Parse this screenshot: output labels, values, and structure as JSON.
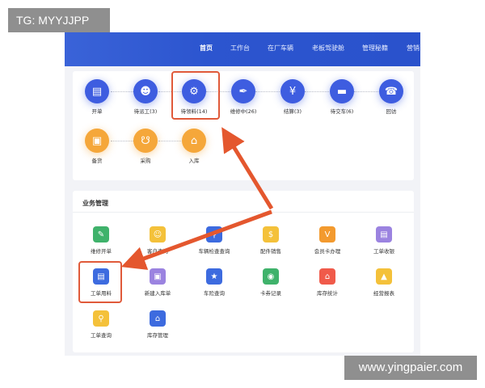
{
  "watermarks": {
    "top_left": "TG: MYYJJPP",
    "bottom_right": "www.yingpaier.com"
  },
  "nav": {
    "items": [
      {
        "label": "首页",
        "active": true
      },
      {
        "label": "工作台"
      },
      {
        "label": "在厂车辆"
      },
      {
        "label": "老板驾驶舱"
      },
      {
        "label": "管理秘籍"
      },
      {
        "label": "营销"
      }
    ]
  },
  "flow": {
    "row1": [
      {
        "label": "开单",
        "icon": "clipboard-icon"
      },
      {
        "label": "待派工(3)",
        "icon": "worker-icon"
      },
      {
        "label": "待领料(14)",
        "icon": "parts-icon"
      },
      {
        "label": "维修中(26)",
        "icon": "wrench-icon"
      },
      {
        "label": "结算(3)",
        "icon": "yen-icon"
      },
      {
        "label": "待交车(6)",
        "icon": "car-icon"
      },
      {
        "label": "回访",
        "icon": "phone-icon"
      }
    ],
    "row2": [
      {
        "label": "备货",
        "icon": "box-icon"
      },
      {
        "label": "采购",
        "icon": "cart-icon"
      },
      {
        "label": "入库",
        "icon": "warehouse-icon"
      }
    ]
  },
  "business": {
    "title": "业务管理",
    "items": [
      {
        "label": "维修开单",
        "icon": "repair-order-icon",
        "color": "#3fb26b"
      },
      {
        "label": "客户查询",
        "icon": "customer-search-icon",
        "color": "#f4c13a"
      },
      {
        "label": "车辆检查查询",
        "icon": "vehicle-check-icon",
        "color": "#3d6bdf"
      },
      {
        "label": "配件销售",
        "icon": "parts-sales-icon",
        "color": "#f4c13a"
      },
      {
        "label": "会员卡办理",
        "icon": "member-card-icon",
        "color": "#f39a2e"
      },
      {
        "label": "工单收银",
        "icon": "cashier-icon",
        "color": "#9b83e0"
      },
      {
        "label": "工单用料",
        "icon": "work-material-icon",
        "color": "#3d6bdf"
      },
      {
        "label": "新建入库单",
        "icon": "new-stock-in-icon",
        "color": "#9b83e0"
      },
      {
        "label": "车险查询",
        "icon": "insurance-icon",
        "color": "#3d6bdf"
      },
      {
        "label": "卡券记录",
        "icon": "coupon-icon",
        "color": "#3fb26b"
      },
      {
        "label": "库存统计",
        "icon": "inventory-icon",
        "color": "#f05a4a"
      },
      {
        "label": "经营报表",
        "icon": "report-icon",
        "color": "#f4c13a"
      },
      {
        "label": "工单查询",
        "icon": "work-order-search-icon",
        "color": "#f4c13a"
      },
      {
        "label": "库存管理",
        "icon": "inventory-manage-icon",
        "color": "#3d6bdf"
      }
    ]
  },
  "colors": {
    "header": "#2c55cf",
    "flow_blue": "#3e5de0",
    "flow_orange": "#f5a73a",
    "highlight": "#e05a3a"
  }
}
